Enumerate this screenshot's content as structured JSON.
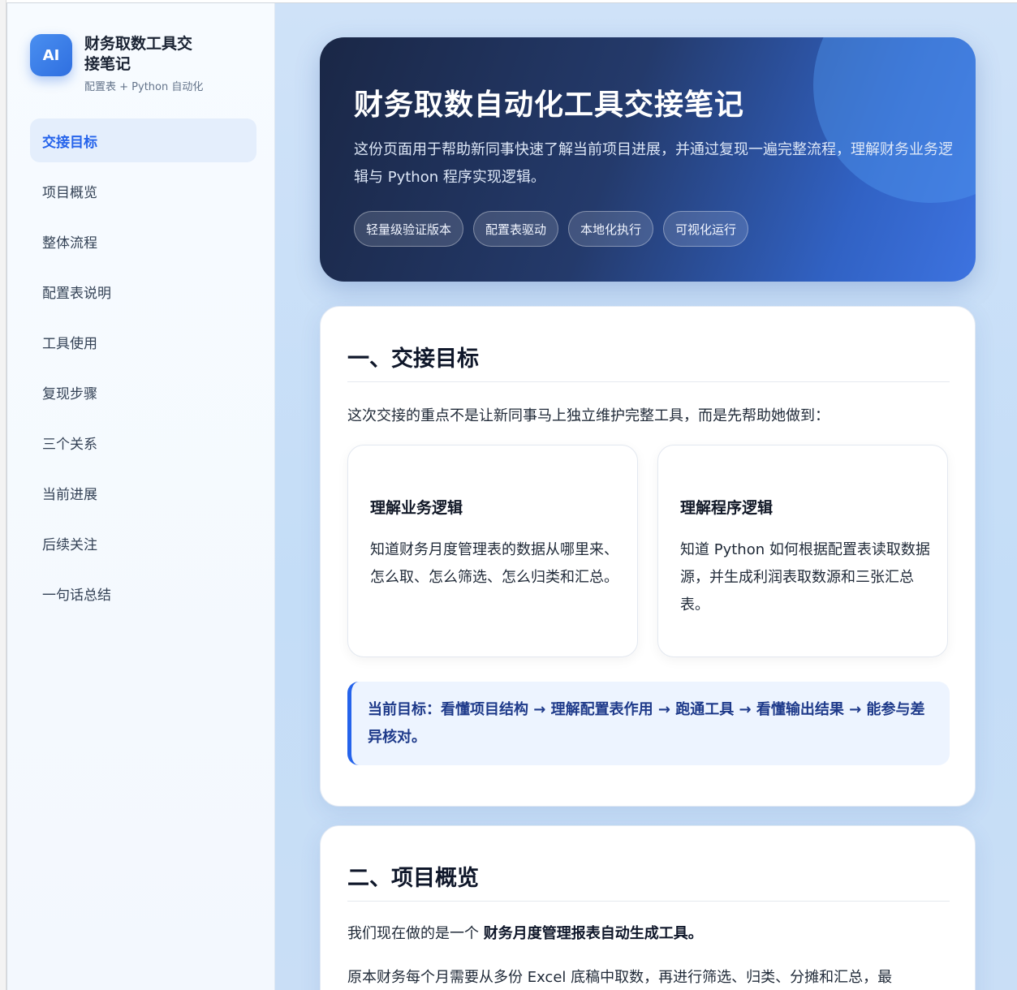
{
  "brand": {
    "logo": "AI",
    "title": "财务取数工具交接笔记",
    "subtitle": "配置表 + Python 自动化"
  },
  "nav": {
    "items": [
      {
        "label": "交接目标"
      },
      {
        "label": "项目概览"
      },
      {
        "label": "整体流程"
      },
      {
        "label": "配置表说明"
      },
      {
        "label": "工具使用"
      },
      {
        "label": "复现步骤"
      },
      {
        "label": "三个关系"
      },
      {
        "label": "当前进展"
      },
      {
        "label": "后续关注"
      },
      {
        "label": "一句话总结"
      }
    ],
    "active_index": 0
  },
  "hero": {
    "title": "财务取数自动化工具交接笔记",
    "description": "这份页面用于帮助新同事快速了解当前项目进展，并通过复现一遍完整流程，理解财务业务逻辑与 Python 程序实现逻辑。",
    "tags": [
      "轻量级验证版本",
      "配置表驱动",
      "本地化执行",
      "可视化运行"
    ]
  },
  "section1": {
    "heading": "一、交接目标",
    "intro": "这次交接的重点不是让新同事马上独立维护完整工具，而是先帮助她做到：",
    "cards": [
      {
        "title": "理解业务逻辑",
        "body": "知道财务月度管理表的数据从哪里来、怎么取、怎么筛选、怎么归类和汇总。"
      },
      {
        "title": "理解程序逻辑",
        "body": "知道 Python 如何根据配置表读取数据源，并生成利润表取数源和三张汇总表。"
      }
    ],
    "callout": "当前目标：看懂项目结构 → 理解配置表作用 → 跑通工具 → 看懂输出结果 → 能参与差异核对。"
  },
  "section2": {
    "heading": "二、项目概览",
    "p1_prefix": "我们现在做的是一个 ",
    "p1_bold": "财务月度管理报表自动生成工具。",
    "p2": "原本财务每个月需要从多份 Excel 底稿中取数，再进行筛选、归类、分摊和汇总，最"
  },
  "colors": {
    "accent": "#2563eb",
    "hero_dark": "#1a2746",
    "hero_light": "#3d73e0"
  }
}
